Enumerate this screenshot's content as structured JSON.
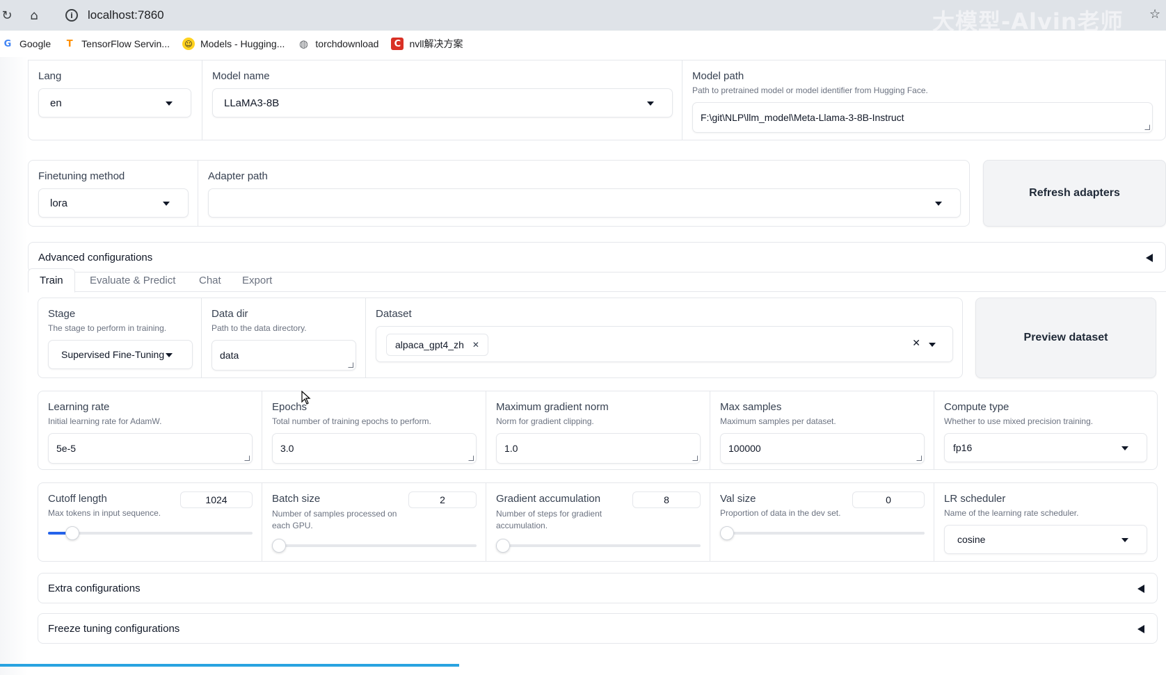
{
  "browser": {
    "url": "localhost:7860",
    "watermark": "大模型-Alvin老师",
    "bookmarks": [
      {
        "label": "Google",
        "icon": "google-icon",
        "color": "#4285f4"
      },
      {
        "label": "TensorFlow Servin...",
        "icon": "tensorflow-icon",
        "color": "#ff8f00"
      },
      {
        "label": "Models - Hugging...",
        "icon": "huggingface-icon",
        "color": "#ffd21e"
      },
      {
        "label": "torchdownload",
        "icon": "globe-icon",
        "color": "#5f6368"
      },
      {
        "label": "nvll解决方案",
        "icon": "c-logo-icon",
        "color": "#d93025"
      }
    ]
  },
  "top": {
    "lang_label": "Lang",
    "lang_value": "en",
    "model_name_label": "Model name",
    "model_name_value": "LLaMA3-8B",
    "model_path_label": "Model path",
    "model_path_desc": "Path to pretrained model or model identifier from Hugging Face.",
    "model_path_value": "F:\\git\\NLP\\llm_model\\Meta-Llama-3-8B-Instruct"
  },
  "finetune": {
    "method_label": "Finetuning method",
    "method_value": "lora",
    "adapter_label": "Adapter path",
    "adapter_value": "",
    "refresh_label": "Refresh adapters"
  },
  "advanced": {
    "label": "Advanced configurations"
  },
  "tabs": [
    "Train",
    "Evaluate & Predict",
    "Chat",
    "Export"
  ],
  "train": {
    "stage_label": "Stage",
    "stage_desc": "The stage to perform in training.",
    "stage_value": "Supervised Fine-Tuning",
    "datadir_label": "Data dir",
    "datadir_desc": "Path to the data directory.",
    "datadir_value": "data",
    "dataset_label": "Dataset",
    "dataset_chip": "alpaca_gpt4_zh",
    "preview_label": "Preview dataset",
    "lr_label": "Learning rate",
    "lr_desc": "Initial learning rate for AdamW.",
    "lr_value": "5e-5",
    "epochs_label": "Epochs",
    "epochs_desc": "Total number of training epochs to perform.",
    "epochs_value": "3.0",
    "gradnorm_label": "Maximum gradient norm",
    "gradnorm_desc": "Norm for gradient clipping.",
    "gradnorm_value": "1.0",
    "maxsamples_label": "Max samples",
    "maxsamples_desc": "Maximum samples per dataset.",
    "maxsamples_value": "100000",
    "compute_label": "Compute type",
    "compute_desc": "Whether to use mixed precision training.",
    "compute_value": "fp16",
    "cutoff_label": "Cutoff length",
    "cutoff_desc": "Max tokens in input sequence.",
    "cutoff_value": "1024",
    "cutoff_fraction": 0.12,
    "batch_label": "Batch size",
    "batch_desc": "Number of samples processed on each GPU.",
    "batch_value": "2",
    "batch_fraction": 0.0,
    "gradacc_label": "Gradient accumulation",
    "gradacc_desc": "Number of steps for gradient accumulation.",
    "gradacc_value": "8",
    "gradacc_fraction": 0.03,
    "valsize_label": "Val size",
    "valsize_desc": "Proportion of data in the dev set.",
    "valsize_value": "0",
    "valsize_fraction": 0.0,
    "scheduler_label": "LR scheduler",
    "scheduler_desc": "Name of the learning rate scheduler.",
    "scheduler_value": "cosine",
    "extra_label": "Extra configurations",
    "freeze_label": "Freeze tuning configurations"
  }
}
